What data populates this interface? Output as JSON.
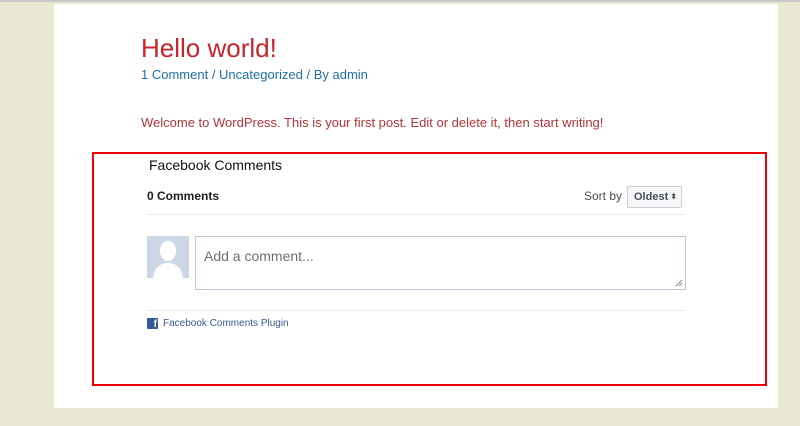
{
  "post": {
    "title": "Hello world!",
    "meta": {
      "comments_link": "1 Comment",
      "separator1": " / ",
      "category_link": "Uncategorized",
      "separator2": " / By ",
      "author_link": "admin"
    },
    "content": "Welcome to WordPress. This is your first post. Edit or delete it, then start writing!"
  },
  "facebook_comments": {
    "heading": "Facebook Comments",
    "count": "0 Comments",
    "sort_label": "Sort by",
    "sort_value": "Oldest",
    "comment_placeholder": "Add a comment...",
    "plugin_label": "Facebook Comments Plugin",
    "highlight_color": "#e00000"
  },
  "icons": {
    "avatar": "default-avatar-icon",
    "facebook": "facebook-icon",
    "sort_caret": "sort-caret-icon",
    "resize": "resize-handle-icon"
  }
}
